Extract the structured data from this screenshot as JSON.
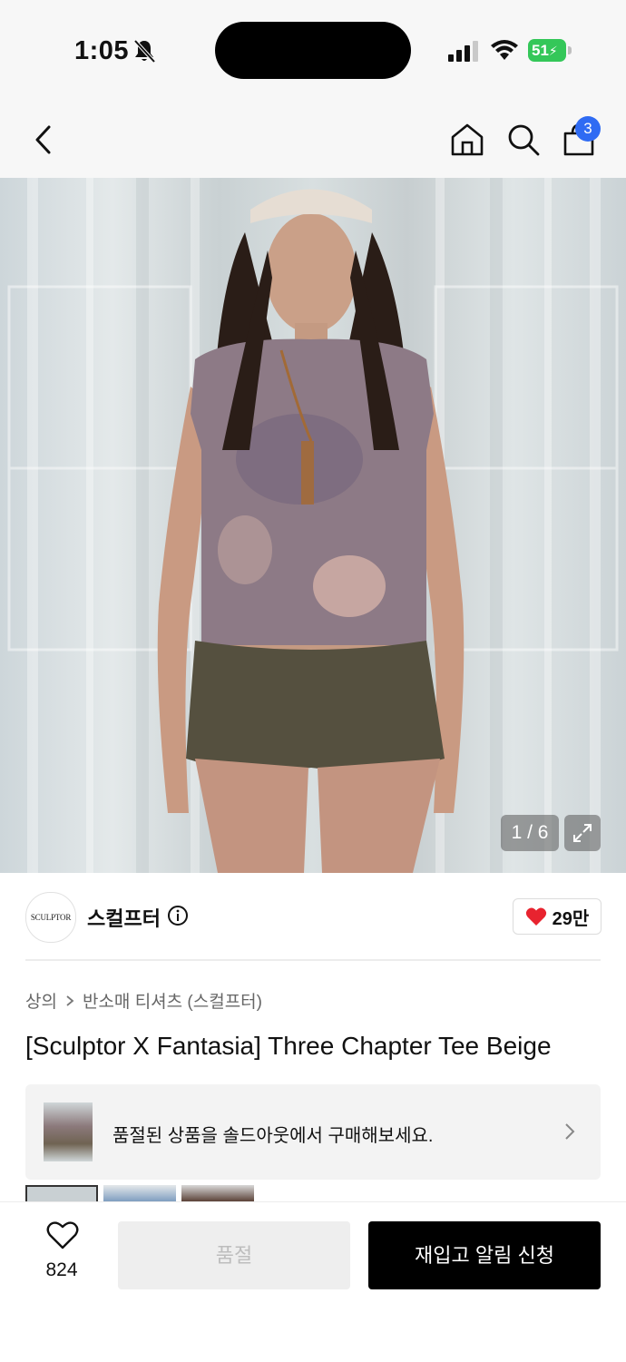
{
  "status_bar": {
    "time": "1:05",
    "battery": "51"
  },
  "nav": {
    "cart_count": "3"
  },
  "gallery": {
    "counter": "1 / 6"
  },
  "brand": {
    "logo_text": "SCULPTOR",
    "name": "스컬프터",
    "likes": "29만"
  },
  "breadcrumb": {
    "category": "상의",
    "subcategory": "반소매 티셔츠 (스컬프터)"
  },
  "product": {
    "title": "[Sculptor X Fantasia] Three Chapter Tee Beige"
  },
  "soldout_banner": {
    "text": "품절된 상품을 솔드아웃에서 구매해보세요."
  },
  "bottom_bar": {
    "wish_count": "824",
    "soldout_label": "품절",
    "restock_label": "재입고 알림 신청"
  },
  "colors": {
    "accent_blue": "#2f6bf3",
    "battery_green": "#34c759",
    "heart_red": "#e8232f"
  }
}
